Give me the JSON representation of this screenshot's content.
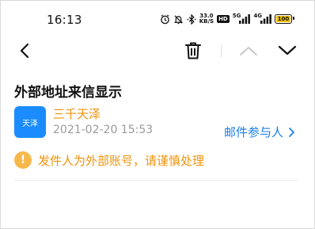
{
  "status_bar": {
    "time": "16:13",
    "net_speed_value": "33.0",
    "net_speed_unit": "KB/S",
    "hd_label": "HD",
    "signal1_label": "5G",
    "signal2_label": "4G",
    "battery_level": "100"
  },
  "email": {
    "subject": "外部地址来信显示",
    "avatar_text": "天泽",
    "sender_name": "三千天泽",
    "date": "2021-02-20 15:53",
    "participants_label": "邮件参与人",
    "warning_text": "发件人为外部账号，请谨慎处理",
    "warning_icon_glyph": "!"
  },
  "colors": {
    "accent_blue": "#1a7fe6",
    "warning_orange": "#f0930b",
    "avatar_blue": "#1a8cff",
    "disabled_gray": "#c8c8c8"
  },
  "icons": {
    "back": "chevron-left-icon",
    "delete": "trash-icon",
    "prev": "chevron-up-icon",
    "next": "chevron-down-icon"
  }
}
